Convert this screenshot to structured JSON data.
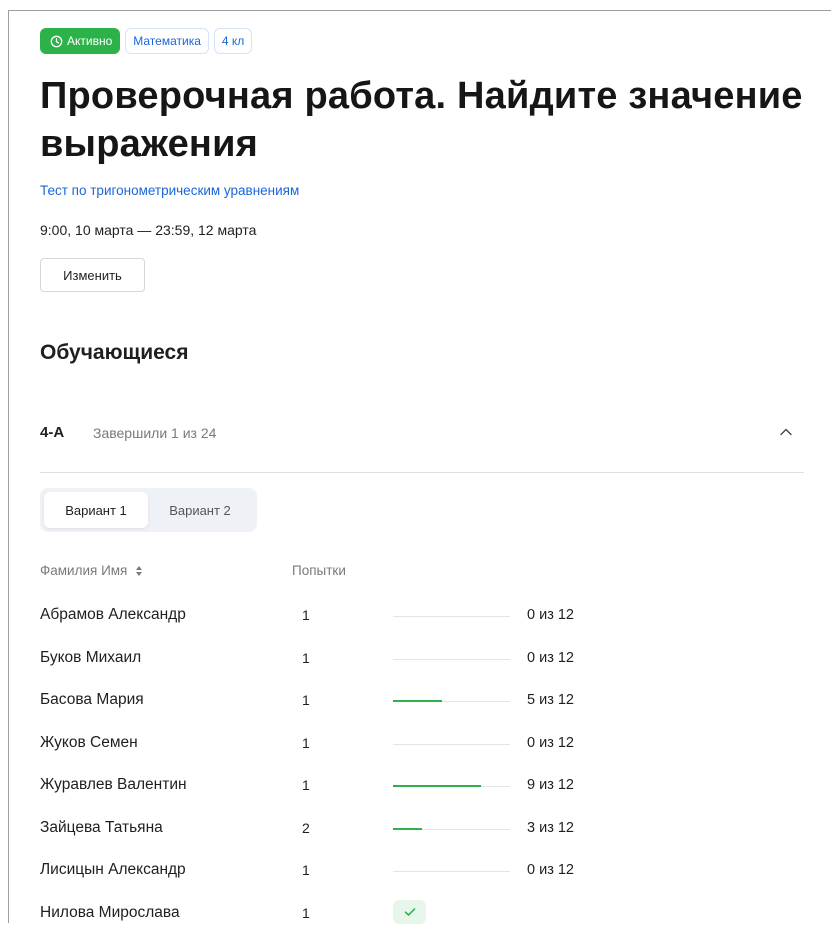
{
  "header": {
    "status_badge": "Активно",
    "subject_badge": "Математика",
    "grade_badge": "4 кл",
    "title": "Проверочная работа. Найдите значение выражения",
    "subtitle": "Тест по тригонометрическим уравнениям",
    "dates": "9:00, 10 марта — 23:59, 12 марта",
    "edit_label": "Изменить"
  },
  "colors": {
    "status_green": "#2db24a",
    "link_blue": "#1a66d9"
  },
  "students_section": {
    "title": "Обучающиеся",
    "group": {
      "name": "4-А",
      "status": "Завершили 1 из 24",
      "expanded": true
    },
    "variants": {
      "tabs": [
        "Вариант 1",
        "Вариант 2"
      ],
      "selected": "Вариант 1"
    },
    "table": {
      "headers": {
        "name": "Фамилия Имя",
        "attempts": "Попытки"
      },
      "rows": [
        {
          "name": "Абрамов Александр",
          "attempts": "1",
          "score": "0 из 12",
          "progress": 0
        },
        {
          "name": "Буков Михаил",
          "attempts": "1",
          "score": "0 из 12",
          "progress": 0
        },
        {
          "name": "Басова Мария",
          "attempts": "1",
          "score": "5 из 12",
          "progress": 0.4167
        },
        {
          "name": "Жуков Семен",
          "attempts": "1",
          "score": "0 из 12",
          "progress": 0
        },
        {
          "name": "Журавлев Валентин",
          "attempts": "1",
          "score": "9 из 12",
          "progress": 0.75
        },
        {
          "name": "Зайцева Татьяна",
          "attempts": "2",
          "score": "3 из 12",
          "progress": 0.25
        },
        {
          "name": "Лисицын Александр",
          "attempts": "1",
          "score": "0 из 12",
          "progress": 0
        },
        {
          "name": "Нилова Мирослава",
          "attempts": "1",
          "score": "",
          "progress": null,
          "completed": true
        }
      ]
    }
  }
}
